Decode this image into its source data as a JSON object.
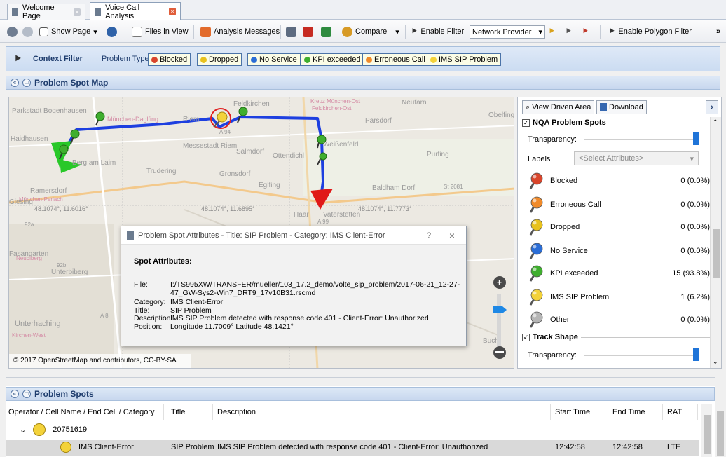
{
  "tabs": [
    {
      "label": "Welcome Page",
      "active": false
    },
    {
      "label": "Voice Call Analysis",
      "active": true
    }
  ],
  "toolbar": {
    "show_page": "Show Page",
    "files_in_view": "Files in View",
    "analysis_messages": "Analysis Messages",
    "compare": "Compare",
    "enable_filter": "Enable Filter",
    "provider_select": "Network Provider",
    "enable_polygon_filter": "Enable Polygon Filter",
    "overflow": "»"
  },
  "context_filter": {
    "title": "Context Filter",
    "problem_type_label": "Problem Type",
    "buttons": [
      "Blocked",
      "Dropped",
      "No Service",
      "KPI exceeded",
      "Erroneous Call",
      "IMS SIP Problem"
    ]
  },
  "map_panel": {
    "title": "Problem Spot Map",
    "attribution": "© 2017 OpenStreetMap and contributors, CC-BY-SA",
    "places": [
      "Parkstadt Bogenhausen",
      "München-Daglfing",
      "Riem",
      "Feldkirchen",
      "Kreuz München-Ost",
      "Feldkirchen-Ost",
      "Neufarn",
      "Obelfing",
      "Parsdorf",
      "Haidhausen",
      "Berg am Laim",
      "Messestadt Riem",
      "Salmdorf",
      "Ottendichl",
      "Weißenfeld",
      "Purfing",
      "Trudering",
      "Gronsdorf",
      "Eglfing",
      "Baldham Dorf",
      "St 2081",
      "Ramersdorf",
      "München-Perlach",
      "Giesing",
      "Haar",
      "Vaterstetten",
      "Neubiberg",
      "Unterbiberg",
      "Fasangarten",
      "Unterhaching",
      "Buch",
      "Kirchen-West",
      "92a",
      "92b",
      "A 8",
      "A 99",
      "A 94"
    ],
    "coord_labels": [
      "48.1074°, 11.6016°",
      "48.1074°, 11.6895°",
      "48.1074°, 11.7773°"
    ]
  },
  "dialog": {
    "title": "Problem Spot Attributes - Title: SIP Problem - Category: IMS Client-Error",
    "help": "?",
    "close": "×",
    "heading": "Spot Attributes:",
    "fields": [
      {
        "label": "File:",
        "value": "I:/TS995XW/TRANSFER/mueller/103_17.2_demo/volte_sip_problem/2017-06-21_12-27-47_GW-Sys2-Win7_DRT9_17v10B31.rscmd"
      },
      {
        "label": "Category:",
        "value": "IMS Client-Error"
      },
      {
        "label": "Title:",
        "value": "SIP Problem"
      },
      {
        "label": "Description:",
        "value": "IMS SIP Problem detected with response code 401 - Client-Error: Unauthorized"
      },
      {
        "label": "Position:",
        "value": "Longitude 11.7009° Latitude 48.1421°"
      }
    ]
  },
  "side_panel": {
    "view_driven_area": "View Driven Area",
    "download": "Download",
    "nqa_section": "NQA Problem Spots",
    "transparency_label": "Transparency:",
    "labels_label": "Labels",
    "labels_select": "<Select Attributes>",
    "legend": [
      {
        "label": "Blocked",
        "count": "0 (0.0%)",
        "color": "#d9452b"
      },
      {
        "label": "Erroneous Call",
        "count": "0 (0.0%)",
        "color": "#f08a2a"
      },
      {
        "label": "Dropped",
        "count": "0 (0.0%)",
        "color": "#e8c21d"
      },
      {
        "label": "No Service",
        "count": "0 (0.0%)",
        "color": "#2a6dd6"
      },
      {
        "label": "KPI exceeded",
        "count": "15 (93.8%)",
        "color": "#3fae2e"
      },
      {
        "label": "IMS SIP Problem",
        "count": "1 (6.2%)",
        "color": "#f3d23a"
      },
      {
        "label": "Other",
        "count": "0 (0.0%)",
        "color": "#b5b5b5"
      }
    ],
    "track_section": "Track Shape",
    "transparency_label2": "Transparency:"
  },
  "bottom_panel": {
    "title": "Problem Spots",
    "columns": [
      "Operator / Cell Name / End Cell / Category",
      "Title",
      "Description",
      "Start Time",
      "End Time",
      "RAT"
    ],
    "group_id": "20751619",
    "row": {
      "category": "IMS Client-Error",
      "title": "SIP Problem",
      "description": "IMS SIP Problem detected with response code 401 - Client-Error: Unauthorized",
      "start": "12:42:58",
      "end": "12:42:58",
      "rat": "LTE"
    }
  }
}
